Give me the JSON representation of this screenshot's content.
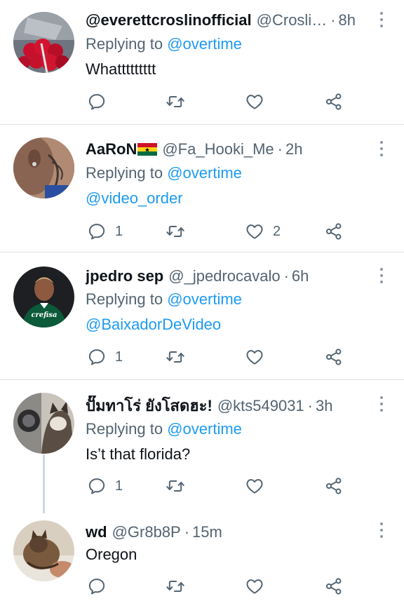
{
  "replying_label": "Replying to",
  "tweets": [
    {
      "name": "@everettcroslinofficial",
      "handle": "@Crosli…",
      "time": "8h",
      "replying_to": "@overtime",
      "text": "Whattttttttt",
      "text_is_link": false,
      "counts": {
        "reply": "",
        "retweet": "",
        "like": ""
      }
    },
    {
      "name": "AaRoN",
      "flag": "Ghana",
      "handle": "@Fa_Hooki_Me",
      "time": "2h",
      "replying_to": "@overtime",
      "text": "@video_order",
      "text_is_link": true,
      "counts": {
        "reply": "1",
        "retweet": "",
        "like": "2"
      }
    },
    {
      "name": "jpedro sep",
      "handle": "@_jpedrocavalo",
      "time": "6h",
      "replying_to": "@overtime",
      "text": "@BaixadorDeVideo",
      "text_is_link": true,
      "jersey_text": "crefisa",
      "counts": {
        "reply": "1",
        "retweet": "",
        "like": ""
      }
    },
    {
      "name": "ปั๊มทาโร่ ยังโสดฮะ!",
      "handle": "@kts549031",
      "time": "3h",
      "replying_to": "@overtime",
      "text": "Is’t that florida?",
      "text_is_link": false,
      "counts": {
        "reply": "1",
        "retweet": "",
        "like": ""
      }
    },
    {
      "name": "wd",
      "handle": "@Gr8b8P",
      "time": "15m",
      "replying_to": "",
      "text": "Oregon",
      "text_is_link": false,
      "counts": {
        "reply": "",
        "retweet": "",
        "like": ""
      }
    }
  ],
  "icons": [
    "reply-icon",
    "retweet-icon",
    "like-icon",
    "share-icon",
    "more-icon"
  ],
  "colors": {
    "link": "#1d9bf0",
    "secondary": "#536471",
    "text": "#0f1419",
    "divider": "#dfe3e6"
  }
}
